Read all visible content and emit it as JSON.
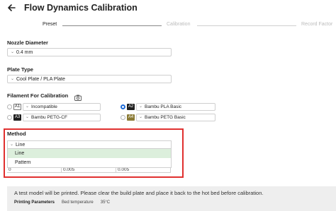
{
  "header": {
    "title": "Flow Dynamics Calibration",
    "back_icon": "arrow-left-icon"
  },
  "steps": [
    {
      "label": "Preset",
      "active": true
    },
    {
      "label": "Calibration",
      "active": false
    },
    {
      "label": "Record Factor",
      "active": false
    }
  ],
  "nozzle": {
    "label": "Nozzle Diameter",
    "value": "0.4 mm"
  },
  "plate": {
    "label": "Plate Type",
    "value": "Cool Plate / PLA Plate"
  },
  "filament": {
    "label": "Filament For Calibration",
    "icon": "camera-icon",
    "slots": [
      {
        "slot": "A1",
        "name": "Incompatible",
        "checked": false
      },
      {
        "slot": "A2",
        "name": "Bambu PLA Basic",
        "checked": true
      },
      {
        "slot": "A3",
        "name": "Bambu PETG-CF",
        "checked": false
      },
      {
        "slot": "A4",
        "name": "Bambu PETG Basic",
        "checked": false
      }
    ]
  },
  "method": {
    "label": "Method",
    "value": "Line",
    "options": [
      "Line",
      "Pattern"
    ]
  },
  "params_row": [
    "0",
    "0.005",
    "0.005"
  ],
  "info": {
    "message": "A test model will be printed. Please clear the build plate and place it back to the hot bed before calibration.",
    "params_label": "Printing Parameters",
    "bed_temp_label": "Bed temperature",
    "bed_temp_value": "35°C"
  },
  "colors": {
    "accent": "#1f6cd8",
    "highlight_border": "#e0302f",
    "hover": "#dcefdc"
  }
}
